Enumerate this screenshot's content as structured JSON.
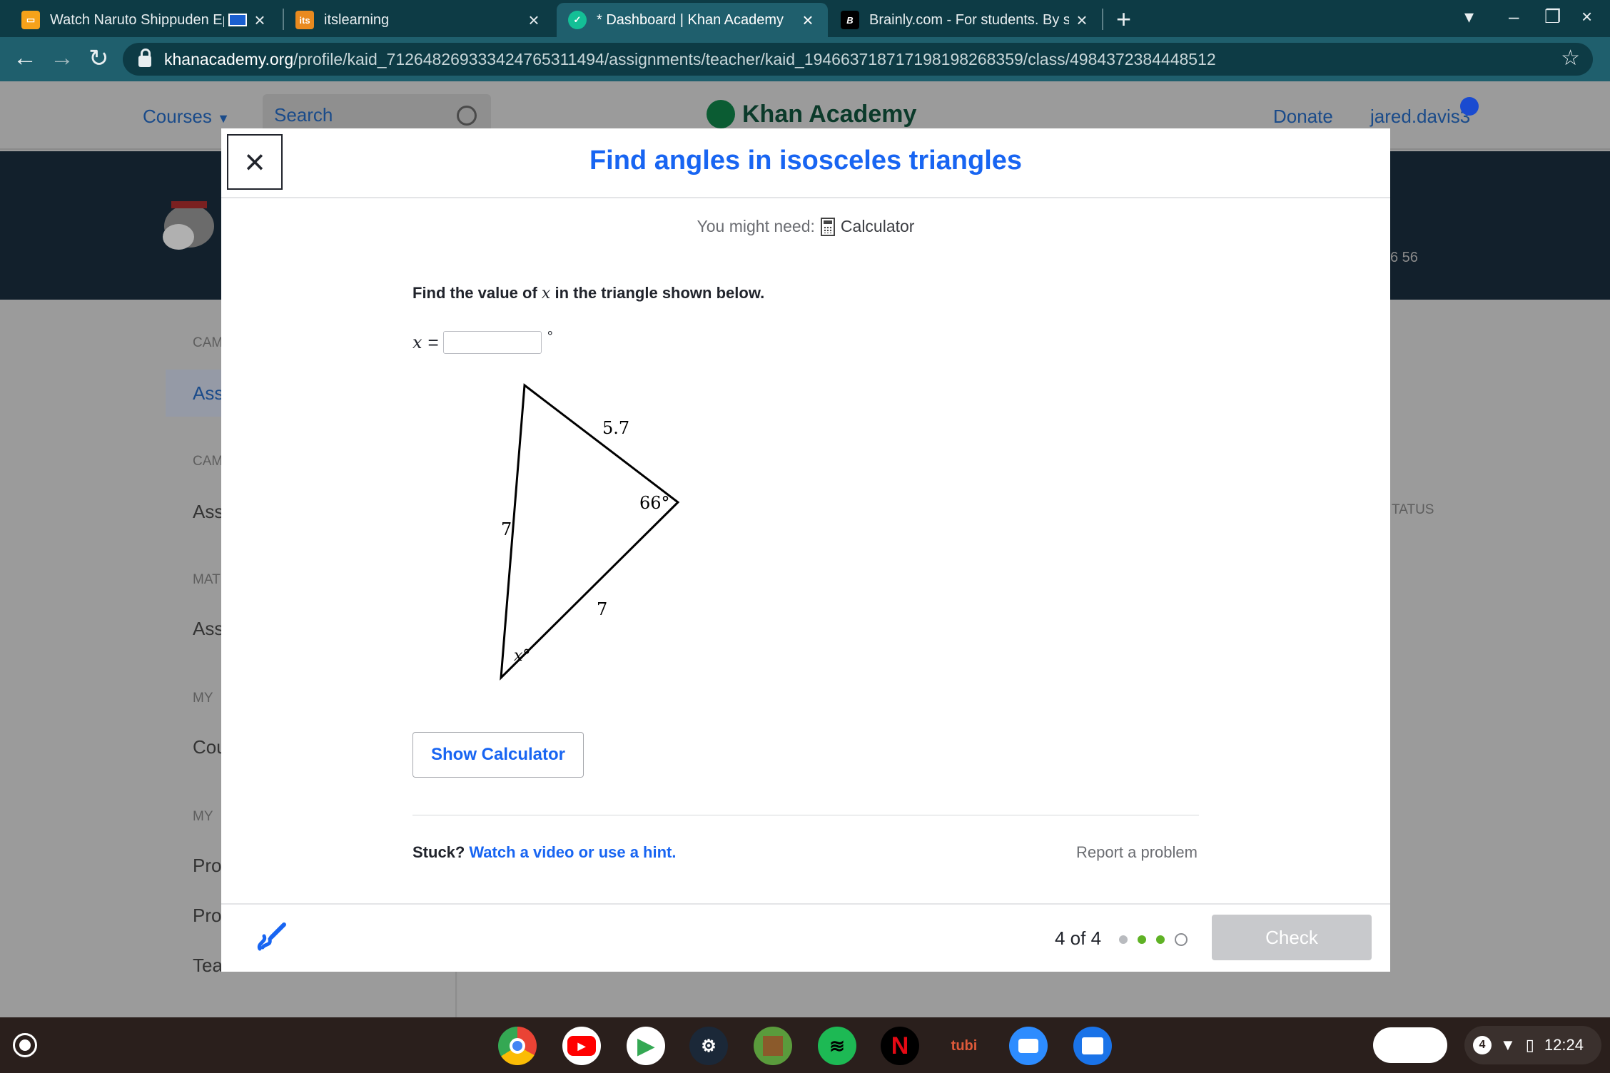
{
  "browser": {
    "tabs": [
      {
        "title": "Watch Naruto Shippuden Ep",
        "favicon": "crunchyroll-icon",
        "favcolor": "#f6a21a"
      },
      {
        "title": "itslearning",
        "favicon": "itslearning-icon",
        "favcolor": "#e98a1f",
        "favtext": "its"
      },
      {
        "title": "* Dashboard | Khan Academy",
        "favicon": "khan-academy-icon",
        "favcolor": "#14bf96"
      },
      {
        "title": "Brainly.com - For students. By stu",
        "favicon": "brainly-icon",
        "favcolor": "#000000",
        "favtext": "B"
      }
    ],
    "url_host": "khanacademy.org",
    "url_path": "/profile/kaid_712648269333424765311494/assignments/teacher/kaid_194663718717198198268359/class/4984372384448512"
  },
  "ka": {
    "courses": "Courses",
    "search_placeholder": "Search",
    "logo": "Khan Academy",
    "donate": "Donate",
    "user": "jared.davis3",
    "points": "6  56",
    "sidebar": [
      {
        "kind": "label",
        "text": "CAM"
      },
      {
        "kind": "item",
        "text": "Ass"
      },
      {
        "kind": "label",
        "text": "CAM"
      },
      {
        "kind": "item",
        "text": "Ass"
      },
      {
        "kind": "label",
        "text": "MAT"
      },
      {
        "kind": "item",
        "text": "Ass"
      },
      {
        "kind": "label",
        "text": "MY"
      },
      {
        "kind": "item",
        "text": "Cou"
      },
      {
        "kind": "label",
        "text": "MY"
      },
      {
        "kind": "item",
        "text": "Pro"
      },
      {
        "kind": "item",
        "text": "Pro"
      },
      {
        "kind": "item",
        "text": "Tea"
      }
    ],
    "status_col": "TATUS"
  },
  "modal": {
    "title": "Find angles in isosceles triangles",
    "might_need": "You might need:",
    "calculator": "Calculator",
    "prompt_before": "Find the value of",
    "prompt_var": "x",
    "prompt_after": "in the triangle shown below.",
    "answer_var": "x",
    "answer_eq": "=",
    "answer_unit": "°",
    "answer_value": "",
    "triangle": {
      "side_top": "5.7",
      "side_left": "7",
      "side_bottom": "7",
      "angle_right": "66°",
      "angle_bottom": "x°"
    },
    "show_calculator": "Show Calculator",
    "stuck": "Stuck?",
    "hint_link": "Watch a video or use a hint.",
    "report": "Report a problem",
    "progress": "4 of 4",
    "check": "Check"
  },
  "shelf": {
    "apps": [
      {
        "name": "chrome-icon",
        "color": "#4285f4"
      },
      {
        "name": "youtube-icon",
        "color": "#ff0000"
      },
      {
        "name": "play-store-icon",
        "color": "#ffffff"
      },
      {
        "name": "steam-icon",
        "color": "#1b2838"
      },
      {
        "name": "minecraft-icon",
        "color": "#5a9b3c"
      },
      {
        "name": "spotify-icon",
        "color": "#1db954"
      },
      {
        "name": "netflix-icon",
        "color": "#000000"
      },
      {
        "name": "tubi-icon",
        "color": "#2a1f1c",
        "text": "tubi"
      },
      {
        "name": "zoom-icon",
        "color": "#2d8cff"
      },
      {
        "name": "files-icon",
        "color": "#1a73e8"
      }
    ],
    "notification_count": "4",
    "time": "12:24"
  }
}
